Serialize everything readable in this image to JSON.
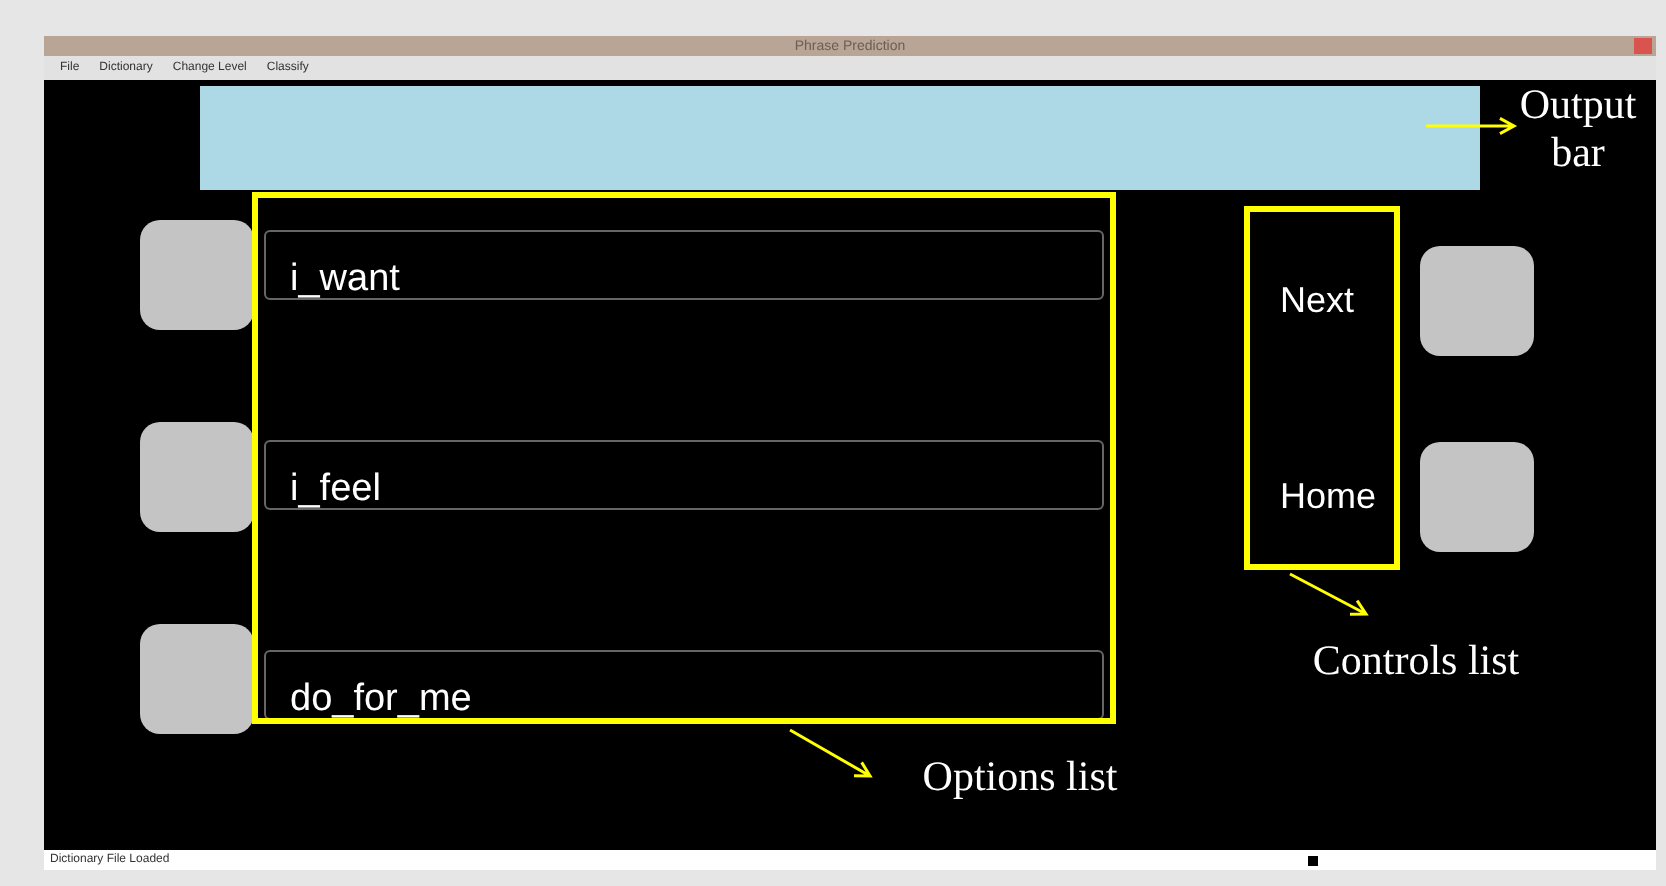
{
  "window": {
    "title": "Phrase Prediction"
  },
  "menu": [
    "File",
    "Dictionary",
    "Change Level",
    "Classify"
  ],
  "options": [
    {
      "label": "i_want"
    },
    {
      "label": "i_feel"
    },
    {
      "label": "do_for_me"
    }
  ],
  "controls": [
    {
      "label": "Next"
    },
    {
      "label": "Home"
    }
  ],
  "annotations": [
    {
      "kind": "output",
      "label": "Output bar"
    },
    {
      "kind": "options",
      "label": "Options list"
    },
    {
      "kind": "controls",
      "label": "Controls list"
    }
  ],
  "status_bar": {
    "text": "Dictionary File Loaded"
  }
}
